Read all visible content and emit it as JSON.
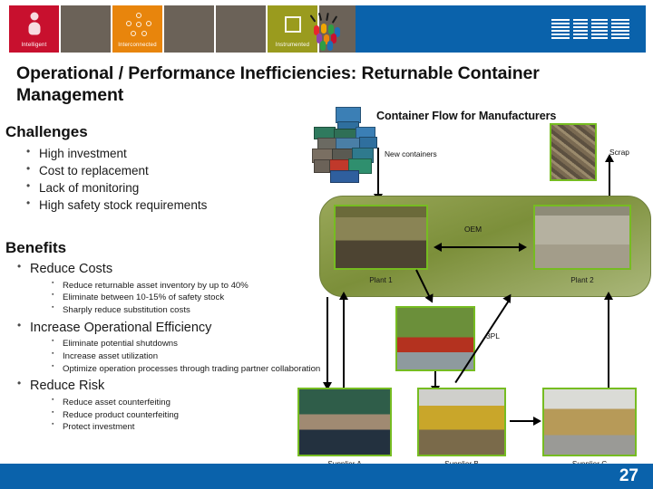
{
  "banner": {
    "tiles": [
      {
        "name": "intelligent",
        "label": "Intelligent",
        "icon": "person-icon"
      },
      {
        "name": "doctor-photo",
        "label": "",
        "icon": "doctor-photo"
      },
      {
        "name": "interconnected",
        "label": "Interconnected",
        "icon": "network-node-icon"
      },
      {
        "name": "baby-photo",
        "label": "",
        "icon": "baby-photo"
      },
      {
        "name": "beach-photo",
        "label": "",
        "icon": "beach-photo"
      },
      {
        "name": "instrumented",
        "label": "Instrumented",
        "icon": "chip-icon"
      },
      {
        "name": "runner-photo",
        "label": "",
        "icon": "runner-photo"
      },
      {
        "name": "smarter-planet",
        "label": "",
        "icon": "globe-bulb-icon"
      }
    ],
    "brand": "IBM",
    "brand_bar_color": "#0a62ab"
  },
  "title": "Operational / Performance Inefficiencies: Returnable Container Management",
  "challenges": {
    "heading": "Challenges",
    "items": [
      "High investment",
      "Cost to replacement",
      "Lack of monitoring",
      "High safety stock requirements"
    ]
  },
  "benefits": {
    "heading": "Benefits",
    "groups": [
      {
        "label": "Reduce Costs",
        "items": [
          "Reduce returnable asset inventory by up to 40%",
          "Eliminate between 10-15% of safety stock",
          "Sharply reduce substitution costs"
        ]
      },
      {
        "label": "Increase Operational Efficiency",
        "items": [
          "Eliminate potential shutdowns",
          "Increase asset utilization",
          "Optimize operation processes through trading partner collaboration"
        ]
      },
      {
        "label": "Reduce Risk",
        "items": [
          "Reduce asset counterfeiting",
          "Reduce product counterfeiting",
          "Protect investment"
        ]
      }
    ]
  },
  "diagram": {
    "title": "Container Flow for Manufacturers",
    "labels": {
      "new_containers": "New containers",
      "scrap": "Scrap",
      "oem": "OEM",
      "plant1": "Plant 1",
      "plant2": "Plant 2",
      "tpl": "3PL",
      "supplier_a": "Supplier A",
      "supplier_b": "Supplier B",
      "supplier_c": "Supplier C"
    },
    "panel_color": "#8a9a4a",
    "photo_border_color": "#76bc21"
  },
  "footer": {
    "page_number": "27",
    "bar_color": "#0a62ab"
  }
}
